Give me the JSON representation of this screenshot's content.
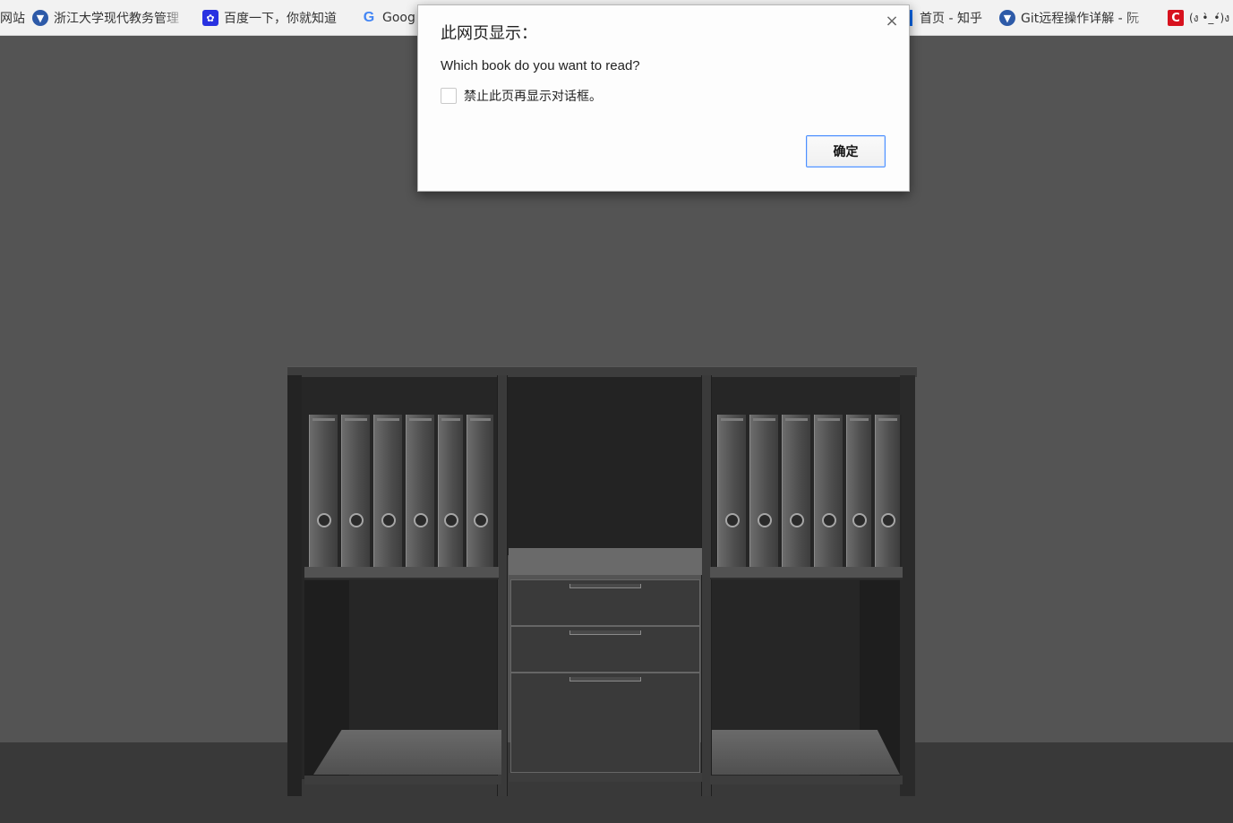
{
  "bookmarks": [
    {
      "label": "网站",
      "icon": "none"
    },
    {
      "label": "浙江大学现代教务管理",
      "icon": "zju-icon"
    },
    {
      "label": "百度一下，你就知道",
      "icon": "baidu-paw-icon"
    },
    {
      "label": "Goog",
      "icon": "google-icon"
    },
    {
      "label": "首页 - 知乎",
      "icon": "zhihu-icon"
    },
    {
      "label": "Git远程操作详解 - 阮",
      "icon": "zju-icon"
    },
    {
      "label": "(ง •̀_•́)ง",
      "icon": "c-icon"
    }
  ],
  "dialog": {
    "title": "此网页显示：",
    "close_glyph": "×",
    "message": "Which book do you want to read?",
    "checkbox_label": "禁止此页再显示对话框。",
    "ok_label": "确定"
  },
  "colors": {
    "scene_bg": "#545454",
    "floor": "#393939",
    "cabinet": "#2e2e2e",
    "ok_border": "#4d90fe"
  }
}
